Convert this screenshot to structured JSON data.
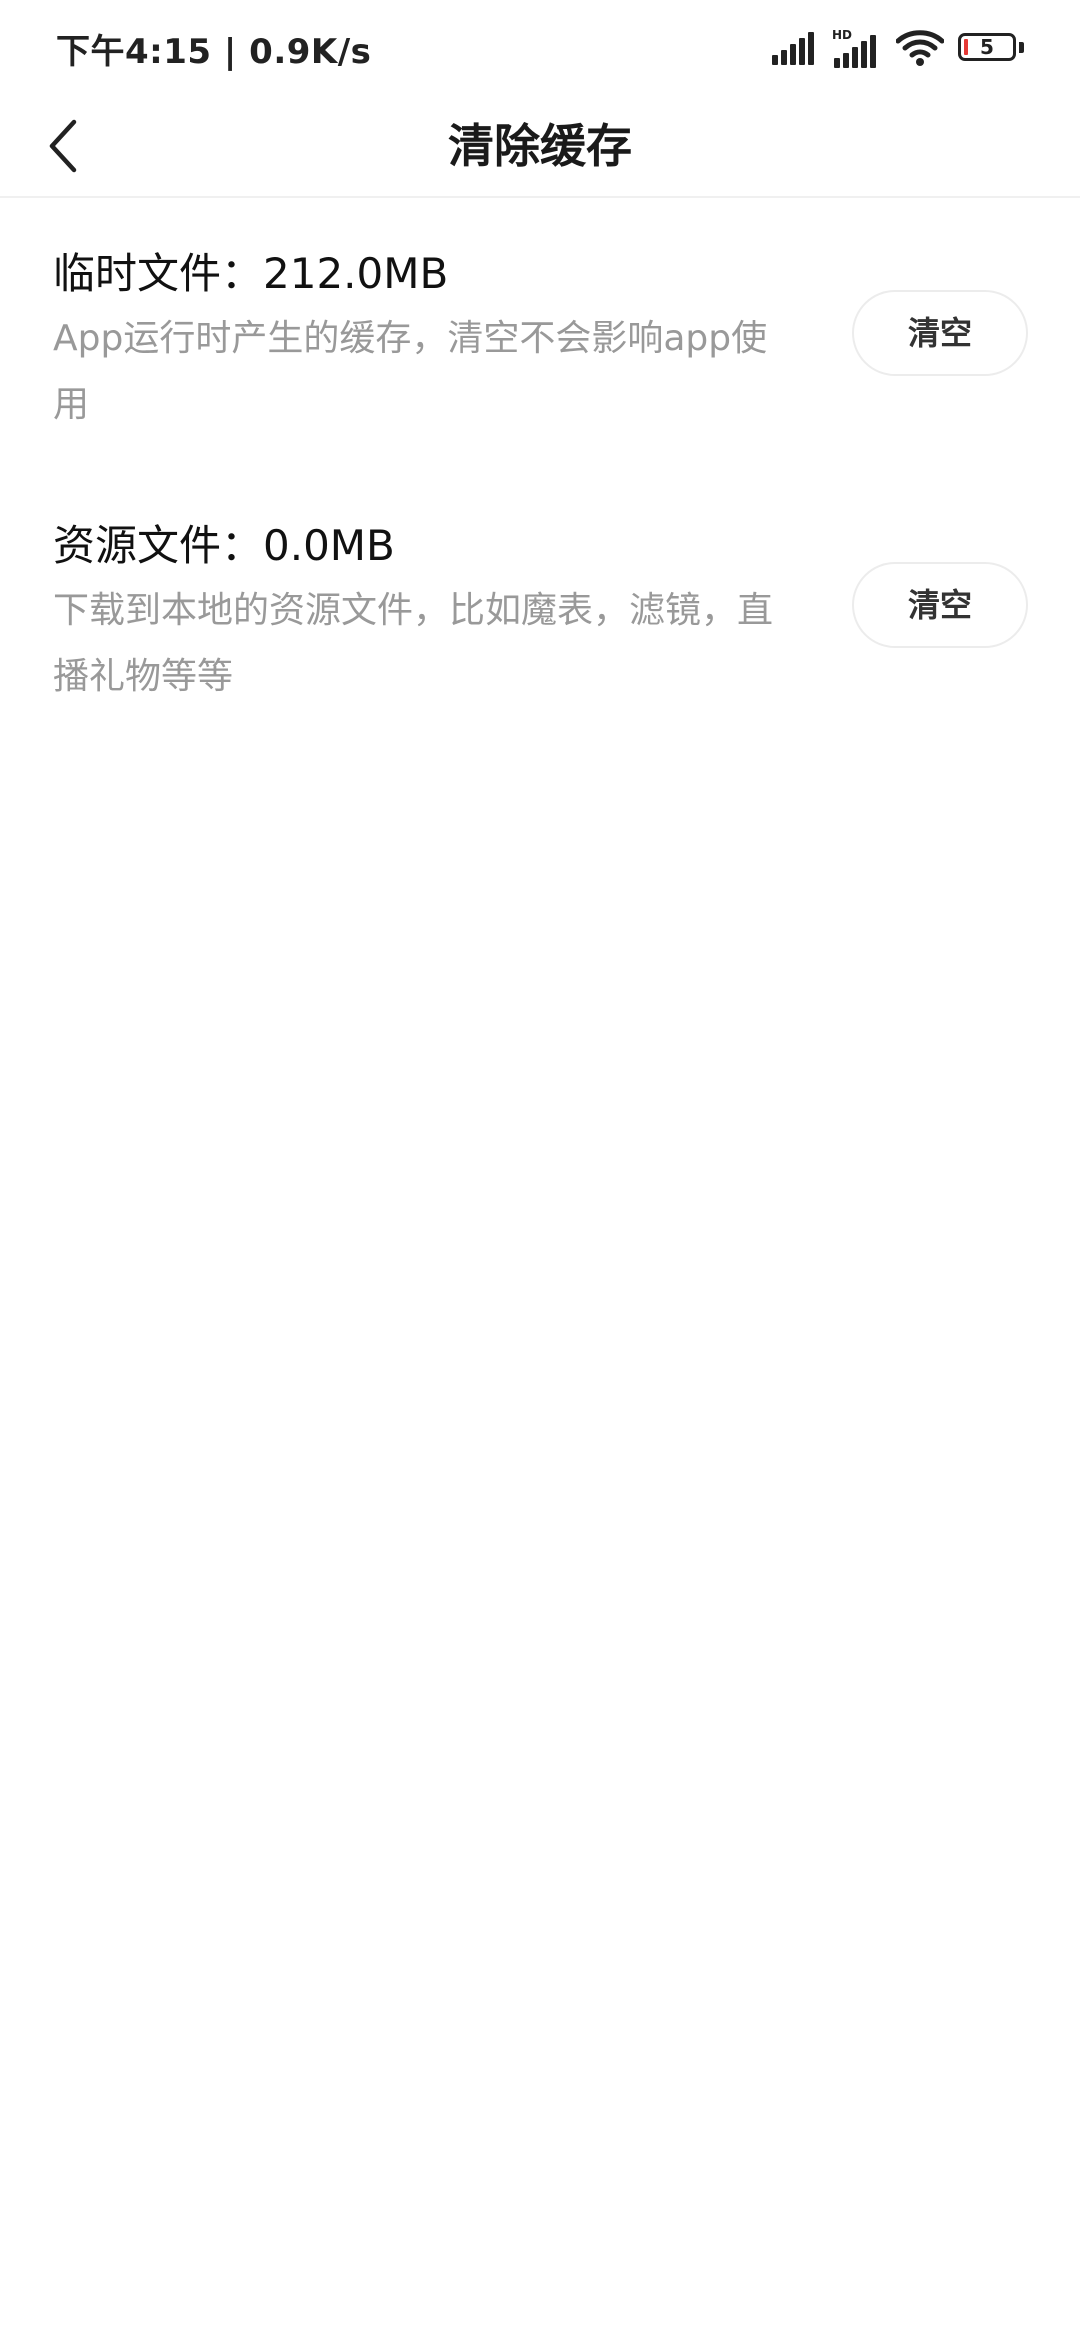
{
  "status_bar": {
    "time_speed": "下午4:15 | 0.9K/s",
    "hd_label": "HD",
    "battery_level": "5",
    "icons": [
      "signal-icon",
      "hd-signal-icon",
      "wifi-icon",
      "battery-icon"
    ]
  },
  "header": {
    "title": "清除缓存",
    "back_icon": "back-chevron-icon"
  },
  "items": [
    {
      "title": "临时文件：212.0MB",
      "description": "App运行时产生的缓存，清空不会影响app使用",
      "button_label": "清空"
    },
    {
      "title": "资源文件：0.0MB",
      "description": "下载到本地的资源文件，比如魔表，滤镜，直播礼物等等",
      "button_label": "清空"
    }
  ],
  "colors": {
    "title_text": "#111111",
    "description_text": "#999999",
    "button_border": "#ececec",
    "battery_low": "#e53935"
  }
}
